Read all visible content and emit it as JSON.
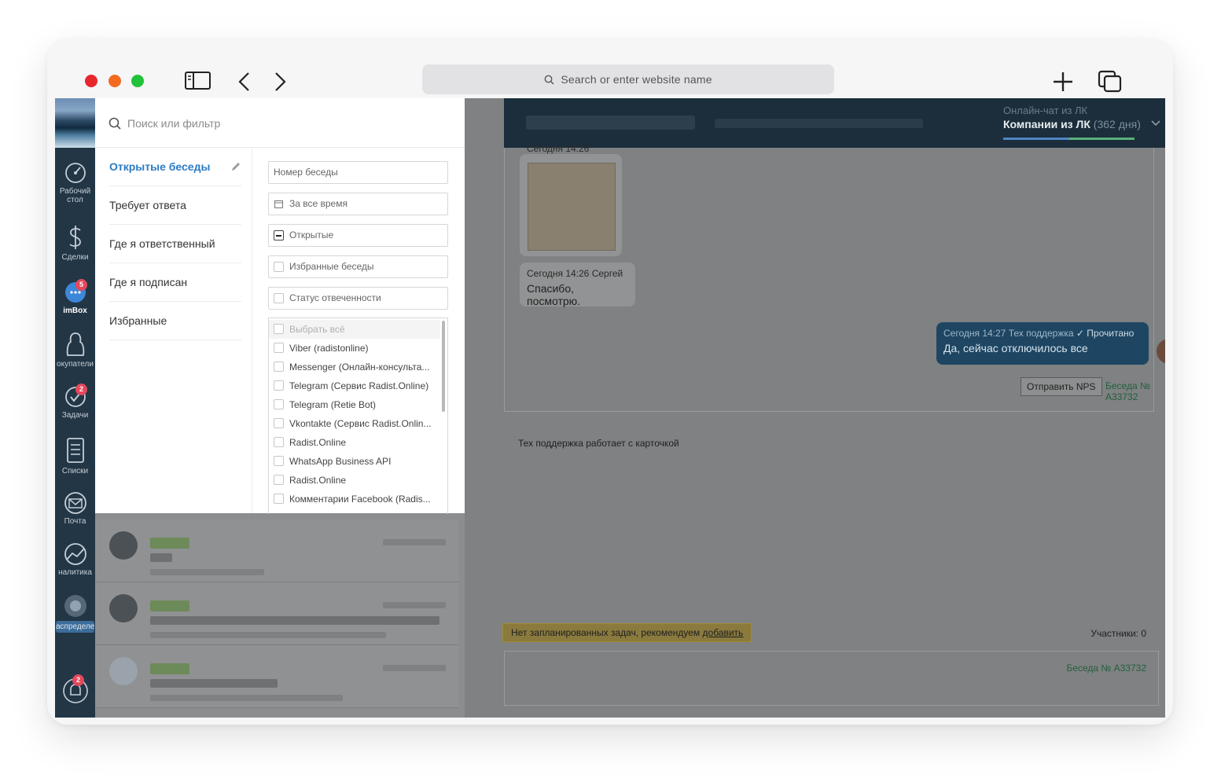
{
  "browser": {
    "url_placeholder": "Search or enter website name"
  },
  "nav": {
    "items": [
      {
        "label": "Рабочий стол",
        "icon": "speedometer-icon"
      },
      {
        "label": "Сделки",
        "icon": "dollar-icon"
      },
      {
        "label": "imBox",
        "icon": "chat-icon",
        "badge": "5"
      },
      {
        "label": "окупатели",
        "icon": "customers-icon"
      },
      {
        "label": "Задачи",
        "icon": "check-icon",
        "badge": "2"
      },
      {
        "label": "Списки",
        "icon": "list-icon"
      },
      {
        "label": "Почта",
        "icon": "mail-icon"
      },
      {
        "label": "налитика",
        "icon": "analytics-icon"
      },
      {
        "label": "аспределе",
        "icon": "distribution-icon"
      }
    ],
    "bell_badge": "2"
  },
  "filter": {
    "search_placeholder": "Поиск или фильтр",
    "categories": [
      "Открытые беседы",
      "Требует ответа",
      "Где я ответственный",
      "Где я подписан",
      "Избранные"
    ],
    "fields": {
      "number": "Номер беседы",
      "period": "За все время",
      "status": "Открытые",
      "favorites": "Избранные беседы",
      "answer_status": "Статус отвеченности"
    },
    "sources": [
      "Выбрать всё",
      "Viber (radistonline)",
      "Messenger (Онлайн-консульта...",
      "Telegram (Сервис Radist.Online)",
      "Telegram (Retie Bot)",
      "Vkontakte (Сервис Radist.Onlin...",
      "Radist.Online",
      "WhatsApp Business API",
      "Radist.Online",
      "Комментарии Facebook (Radis..."
    ]
  },
  "header": {
    "sub": "Онлайн-чат из ЛК",
    "main": "Компании из ЛК",
    "days": "(362 дня)"
  },
  "chat": {
    "msg_preview_time": "Сегодня 14:26",
    "msg1_meta": "Сегодня 14:26 Сергей",
    "msg1_text": "Спасибо, посмотрю.",
    "msg2_meta": "Сегодня 14:27 Тех поддержка",
    "msg2_status": "Прочитано",
    "msg2_text": "Да, сейчас отключилось все",
    "nps_button": "Отправить NPS",
    "conversation_link": "Беседа № A33732",
    "support_note": "Тех поддержка работает с карточкой",
    "task_text": "Нет запланированных задач, рекомендуем",
    "task_link": "добавить",
    "participants": "Участники: 0",
    "compose_link": "Беседа № A33732"
  },
  "colors": {
    "accent": "#2b7bc5",
    "nav_bg": "#223646",
    "header_bg": "#1c2e3b"
  }
}
